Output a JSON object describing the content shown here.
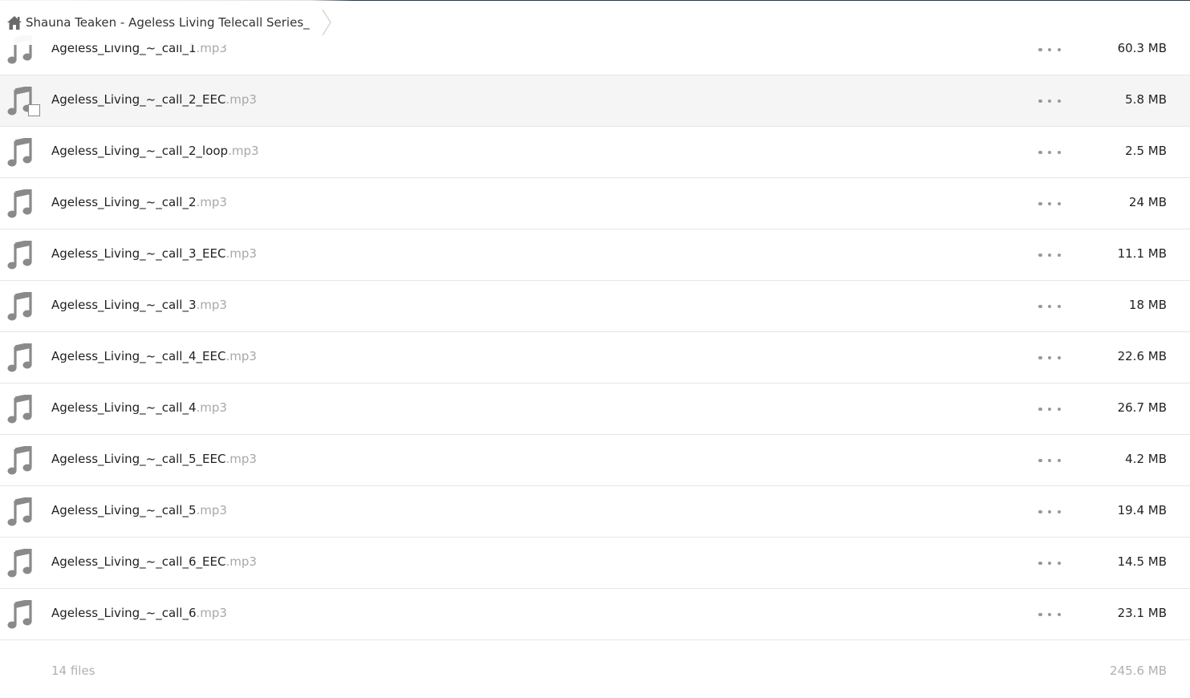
{
  "breadcrumb": {
    "home_icon": "home-icon",
    "folder_name": "Shauna Teaken - Ageless Living Telecall Series_"
  },
  "files": [
    {
      "base": "Ageless_Living_~_call_1",
      "ext": ".mp3",
      "size": "60.3 MB"
    },
    {
      "base": "Ageless_Living_~_call_2_EEC",
      "ext": ".mp3",
      "size": "5.8 MB"
    },
    {
      "base": "Ageless_Living_~_call_2_loop",
      "ext": ".mp3",
      "size": "2.5 MB"
    },
    {
      "base": "Ageless_Living_~_call_2",
      "ext": ".mp3",
      "size": "24 MB"
    },
    {
      "base": "Ageless_Living_~_call_3_EEC",
      "ext": ".mp3",
      "size": "11.1 MB"
    },
    {
      "base": "Ageless_Living_~_call_3",
      "ext": ".mp3",
      "size": "18 MB"
    },
    {
      "base": "Ageless_Living_~_call_4_EEC",
      "ext": ".mp3",
      "size": "22.6 MB"
    },
    {
      "base": "Ageless_Living_~_call_4",
      "ext": ".mp3",
      "size": "26.7 MB"
    },
    {
      "base": "Ageless_Living_~_call_5_EEC",
      "ext": ".mp3",
      "size": "4.2 MB"
    },
    {
      "base": "Ageless_Living_~_call_5",
      "ext": ".mp3",
      "size": "19.4 MB"
    },
    {
      "base": "Ageless_Living_~_call_6_EEC",
      "ext": ".mp3",
      "size": "14.5 MB"
    },
    {
      "base": "Ageless_Living_~_call_6",
      "ext": ".mp3",
      "size": "23.1 MB"
    }
  ],
  "footer": {
    "file_count": "14 files",
    "total_size": "245.6 MB"
  },
  "icons": {
    "file": "music-note-icon",
    "more": "more-options-icon"
  },
  "colors": {
    "icon_gray": "#8a8a8a",
    "extension_gray": "#a8a8a8",
    "hover_row": "#f5f5f5"
  }
}
